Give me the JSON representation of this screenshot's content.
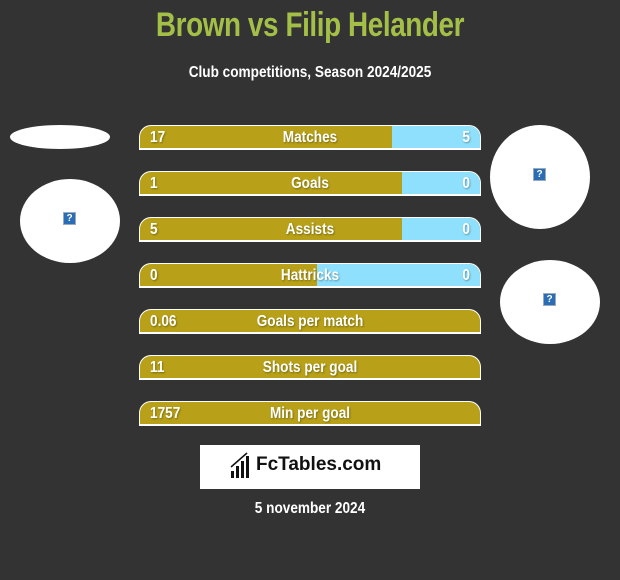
{
  "header": {
    "title": "Brown vs Filip Helander",
    "subtitle": "Club competitions, Season 2024/2025"
  },
  "colors": {
    "left_bar": "#b8a118",
    "right_bar": "#8fe0fc",
    "title": "#a4bf47",
    "background": "#333333"
  },
  "stats": [
    {
      "label": "Matches",
      "left": "17",
      "right": "5",
      "right_fraction": 0.26
    },
    {
      "label": "Goals",
      "left": "1",
      "right": "0",
      "right_fraction": 0.23
    },
    {
      "label": "Assists",
      "left": "5",
      "right": "0",
      "right_fraction": 0.23
    },
    {
      "label": "Hattricks",
      "left": "0",
      "right": "0",
      "right_fraction": 0.48
    },
    {
      "label": "Goals per match",
      "left": "0.06",
      "right": "",
      "right_fraction": 0
    },
    {
      "label": "Shots per goal",
      "left": "11",
      "right": "",
      "right_fraction": 0
    },
    {
      "label": "Min per goal",
      "left": "1757",
      "right": "",
      "right_fraction": 0
    }
  ],
  "images": {
    "placeholder_icon": "?"
  },
  "logo": {
    "text": "FcTables.com",
    "icon": "bar-chart-icon"
  },
  "footer": {
    "date": "5 november 2024"
  }
}
